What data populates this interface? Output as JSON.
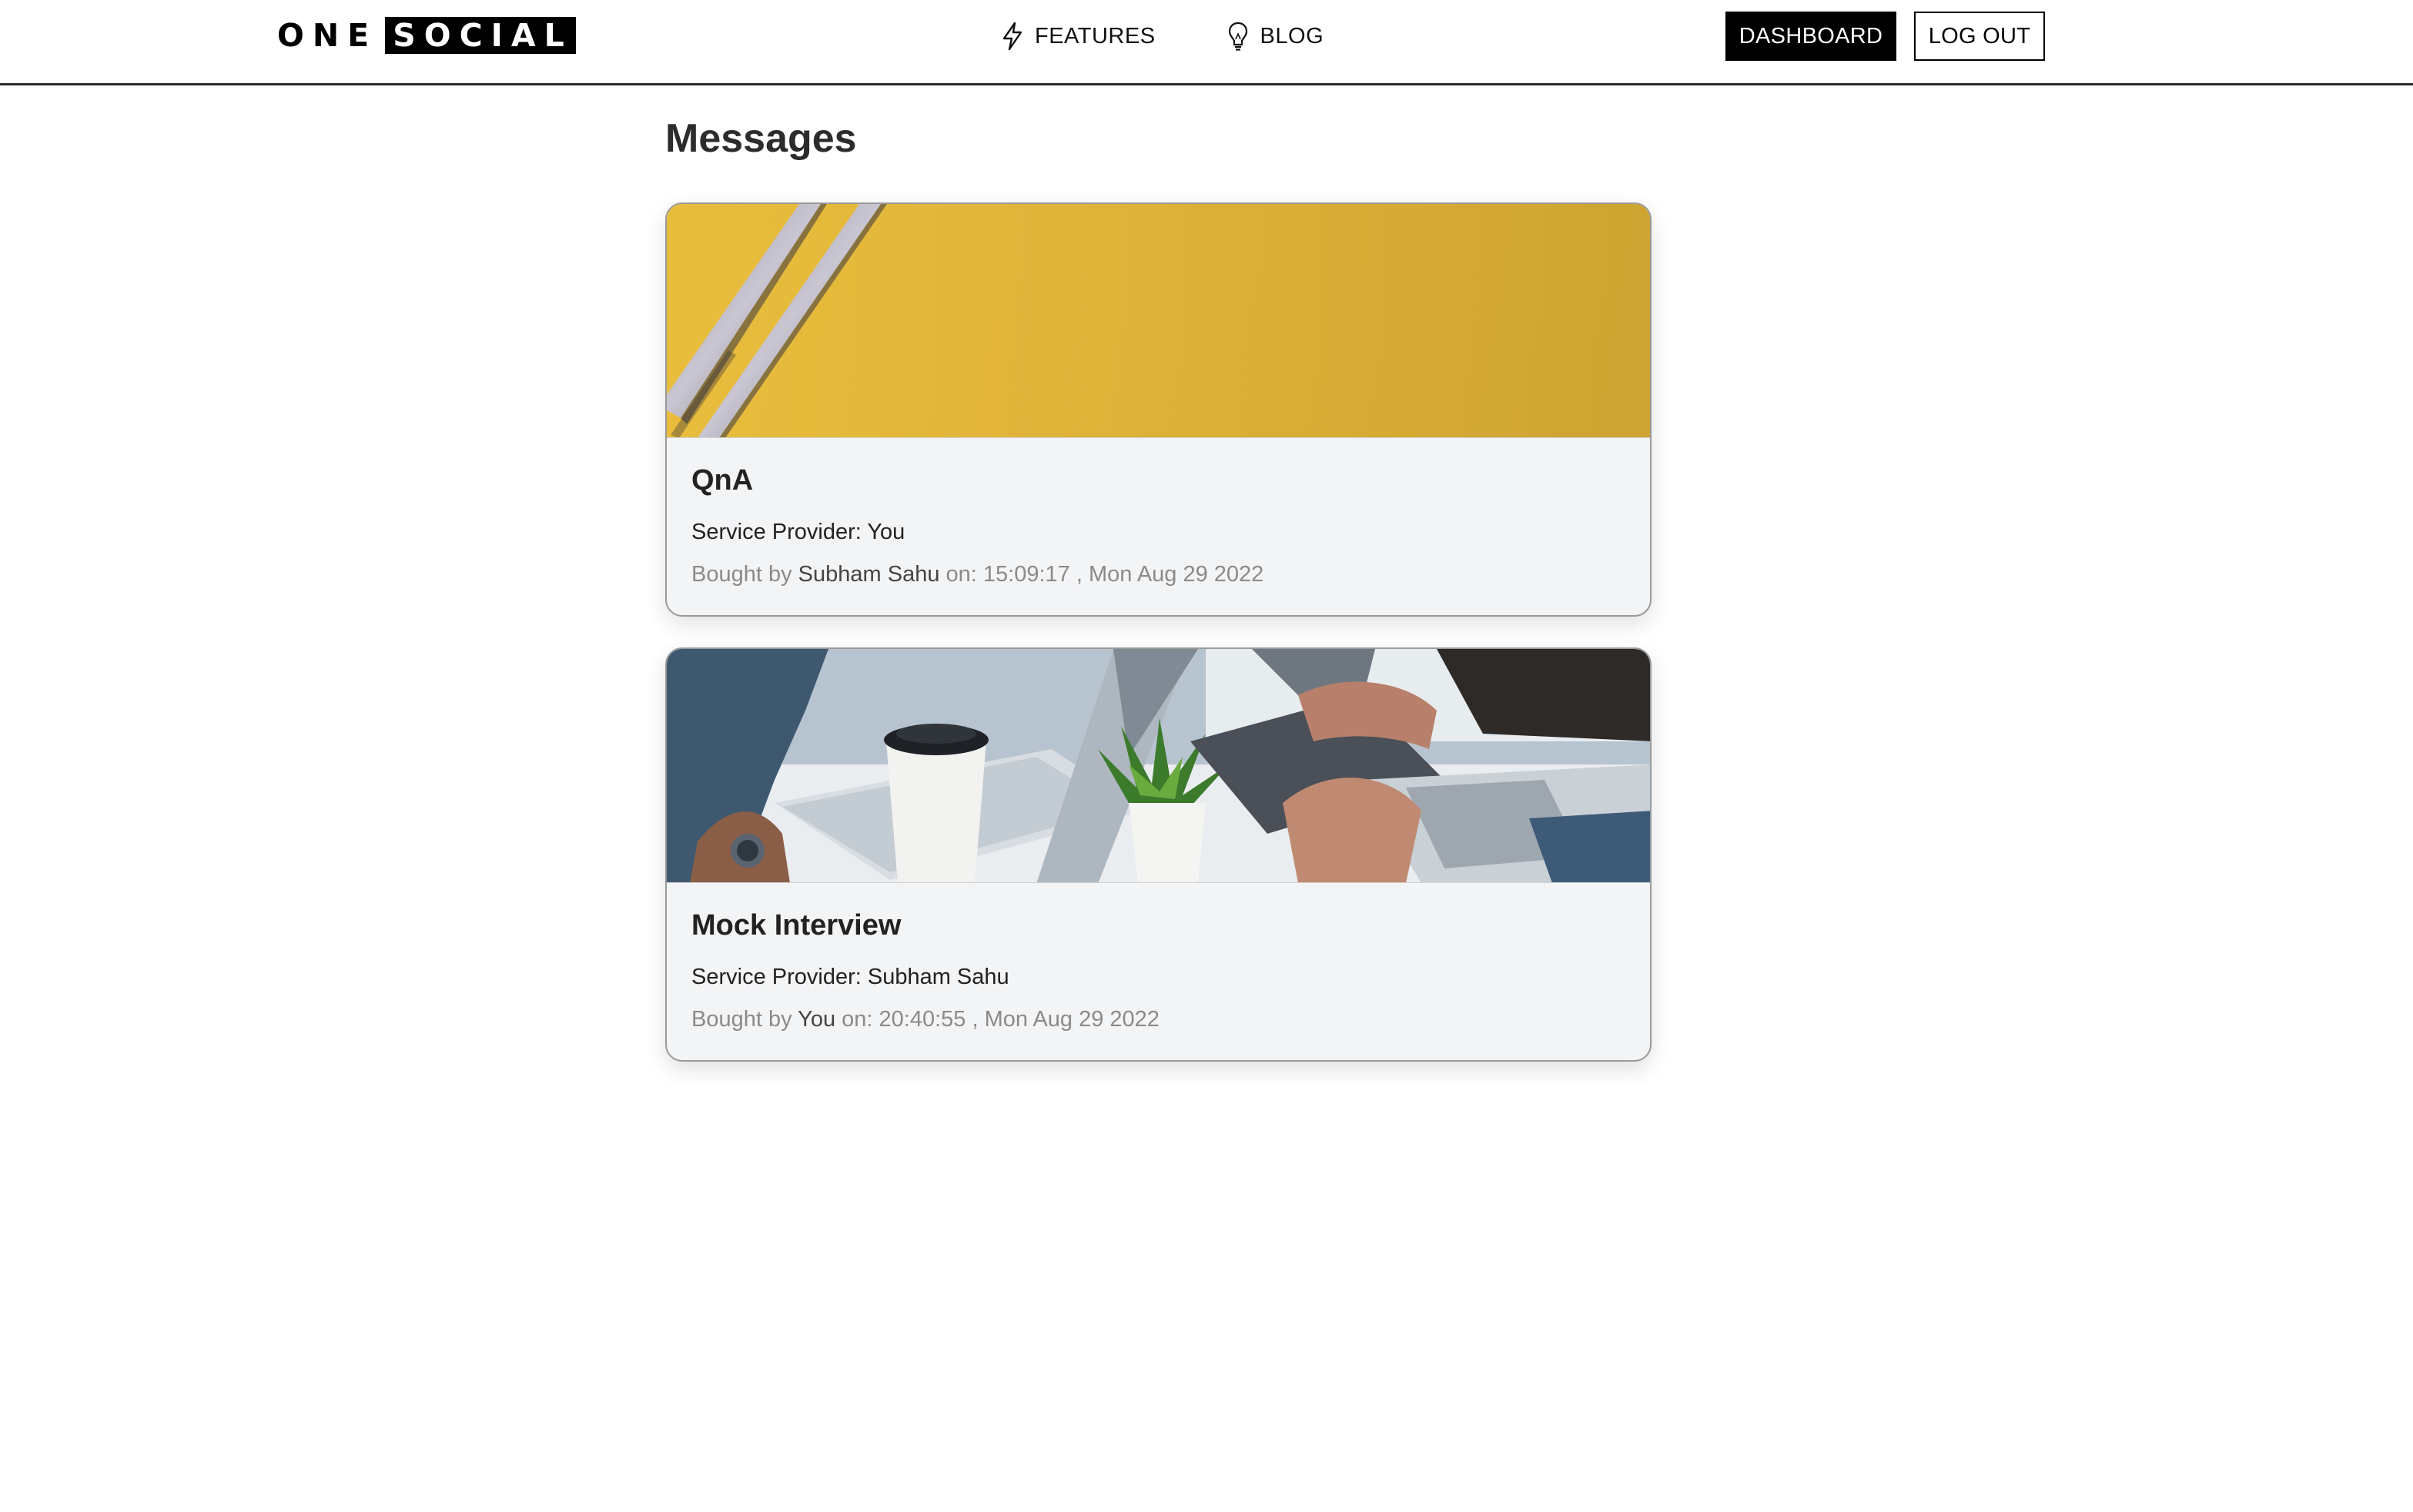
{
  "nav": {
    "logo_one": "ONE",
    "logo_social": "SOCIAL",
    "features_label": "FEATURES",
    "features_icon": "lightning-icon",
    "blog_label": "BLOG",
    "blog_icon": "lightbulb-icon",
    "dashboard_label": "DASHBOARD",
    "logout_label": "LOG OUT"
  },
  "page": {
    "title": "Messages"
  },
  "messages": [
    {
      "title": "QnA",
      "provider_label": "Service Provider: ",
      "provider": "You",
      "bought_prefix": "Bought by ",
      "buyer": "Subham Sahu",
      "time_text": " on: 15:09:17 , Mon Aug 29 2022",
      "image": "yellow-paper-pencils-photo"
    },
    {
      "title": "Mock Interview",
      "provider_label": "Service Provider: ",
      "provider": "Subham Sahu",
      "bought_prefix": "Bought by ",
      "buyer": "You",
      "time_text": " on: 20:40:55 , Mon Aug 29 2022",
      "image": "desk-laptop-coffee-photo"
    }
  ],
  "colors": {
    "accent": "#000000",
    "card_bg": "#f3f4f6",
    "meta_text": "#8a8a8a"
  }
}
